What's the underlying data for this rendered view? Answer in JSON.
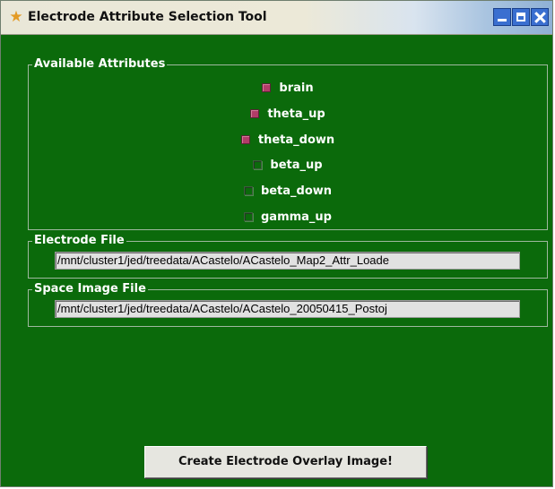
{
  "window": {
    "title": "Electrode Attribute Selection Tool",
    "icon": "star-icon",
    "controls": [
      "minimize-icon",
      "maximize-icon",
      "close-icon"
    ]
  },
  "attributes": {
    "label": "Available Attributes",
    "items": [
      {
        "label": "brain",
        "checked": true
      },
      {
        "label": "theta_up",
        "checked": true
      },
      {
        "label": "theta_down",
        "checked": true
      },
      {
        "label": "beta_up",
        "checked": false
      },
      {
        "label": "beta_down",
        "checked": false
      },
      {
        "label": "gamma_up",
        "checked": false
      }
    ]
  },
  "electrode_file": {
    "label": "Electrode File",
    "value": "/mnt/cluster1/jed/treedata/ACastelo/ACastelo_Map2_Attr_Loade"
  },
  "space_image_file": {
    "label": "Space Image File",
    "value": "/mnt/cluster1/jed/treedata/ACastelo/ACastelo_20050415_Postoj"
  },
  "actions": {
    "create_label": "Create Electrode Overlay Image!"
  },
  "colors": {
    "background": "#0b6a0b",
    "checked": "#b23c68",
    "titlebar_buttons": "#3a6fd0"
  }
}
